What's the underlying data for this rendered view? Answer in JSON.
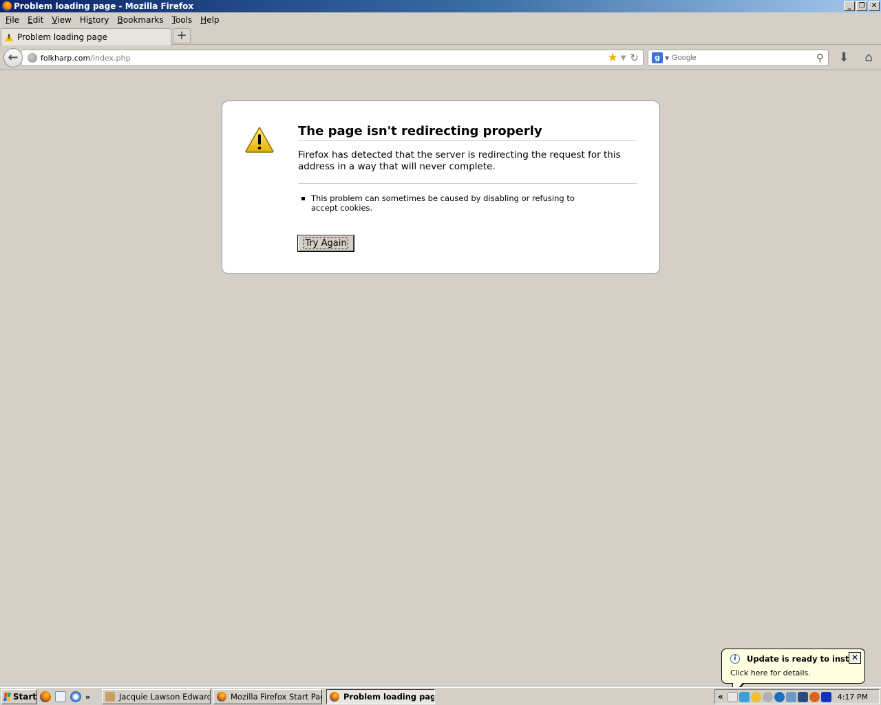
{
  "window": {
    "title": "Problem loading page - Mozilla Firefox",
    "controls": {
      "minimize": "_",
      "restore": "❐",
      "close": "✕"
    }
  },
  "menu": [
    {
      "label": "File",
      "acc": "F",
      "rest": "ile"
    },
    {
      "label": "Edit",
      "acc": "E",
      "rest": "dit"
    },
    {
      "label": "View",
      "acc": "V",
      "rest": "iew"
    },
    {
      "label": "History",
      "acc": "",
      "pre": "Hi",
      "mid": "s",
      "post": "tory"
    },
    {
      "label": "Bookmarks",
      "acc": "B",
      "rest": "ookmarks"
    },
    {
      "label": "Tools",
      "acc": "T",
      "rest": "ools"
    },
    {
      "label": "Help",
      "acc": "H",
      "rest": "elp"
    }
  ],
  "tabs": {
    "active_label": "Problem loading page",
    "new_tab_symbol": "+"
  },
  "navbar": {
    "url_host": "folkharp.com",
    "url_path": "/index.php",
    "search_placeholder": "Google",
    "search_engine_letter": "g"
  },
  "error": {
    "title": "The page isn't redirecting properly",
    "description": "Firefox has detected that the server is redirecting the request for this address in a way that will never complete.",
    "bullets": [
      "This problem can sometimes be caused by disabling or refusing to accept cookies."
    ],
    "button_label": "Try Again"
  },
  "balloon": {
    "title": "Update is ready to install",
    "body": "Click here for details.",
    "close_symbol": "✕"
  },
  "taskbar": {
    "start_label": "Start",
    "overflow_symbol": "»",
    "tasks": [
      {
        "label": "Jacquie Lawson Edwardi...",
        "icon": "card-icon"
      },
      {
        "label": "Mozilla Firefox Start Pag...",
        "icon": "firefox-icon"
      },
      {
        "label": "Problem loading page...",
        "icon": "firefox-icon",
        "active": true
      }
    ],
    "tray_chevron": "«",
    "clock": "4:17 PM"
  },
  "colors": {
    "titlebar_start": "#0a246a",
    "titlebar_end": "#a6caf0",
    "chrome_bg": "#d4d0c8",
    "warning_yellow": "#f2c200",
    "balloon_bg": "#ffffe1"
  }
}
